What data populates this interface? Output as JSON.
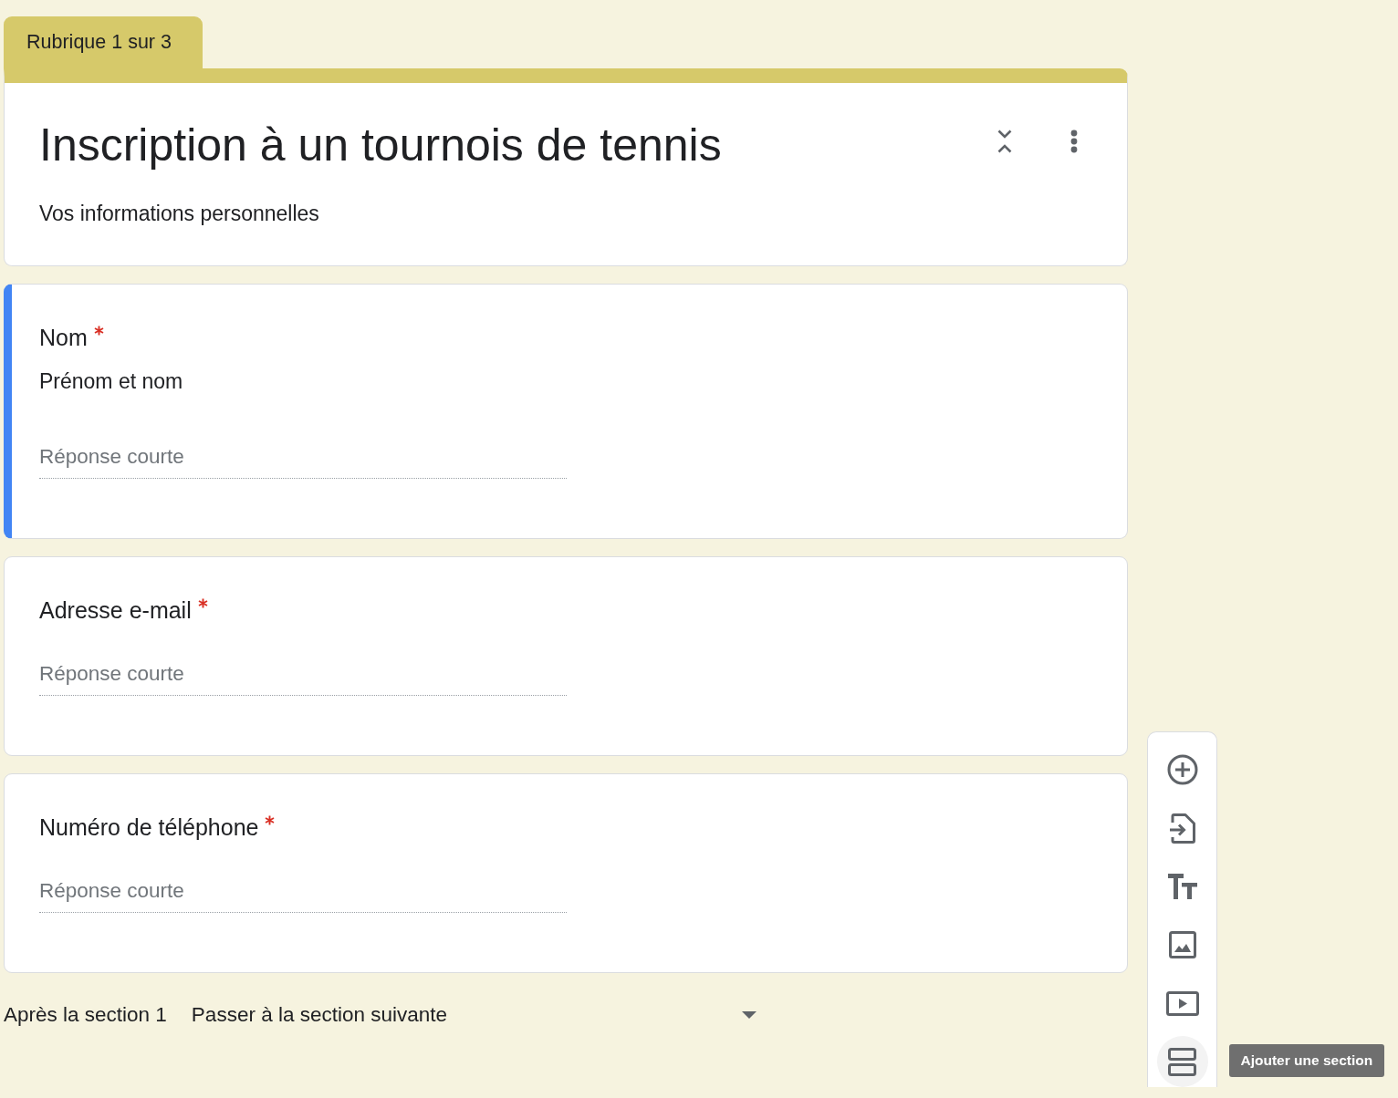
{
  "section_tab": {
    "label": "Rubrique 1 sur 3"
  },
  "header": {
    "title": "Inscription à un tournois de tennis",
    "description": "Vos informations personnelles"
  },
  "questions": [
    {
      "title": "Nom",
      "required": true,
      "description": "Prénom et nom",
      "placeholder": "Réponse courte",
      "selected": true
    },
    {
      "title": "Adresse e-mail",
      "required": true,
      "placeholder": "Réponse courte",
      "selected": false
    },
    {
      "title": "Numéro de téléphone",
      "required": true,
      "placeholder": "Réponse courte",
      "selected": false
    }
  ],
  "after_section": {
    "label": "Après la section 1",
    "value": "Passer à la section suivante"
  },
  "toolbar": {
    "items": [
      {
        "hovered": false
      },
      {
        "hovered": false
      },
      {
        "hovered": false
      },
      {
        "hovered": false
      },
      {
        "hovered": false
      },
      {
        "hovered": true,
        "tooltip": "Ajouter une section"
      }
    ]
  }
}
